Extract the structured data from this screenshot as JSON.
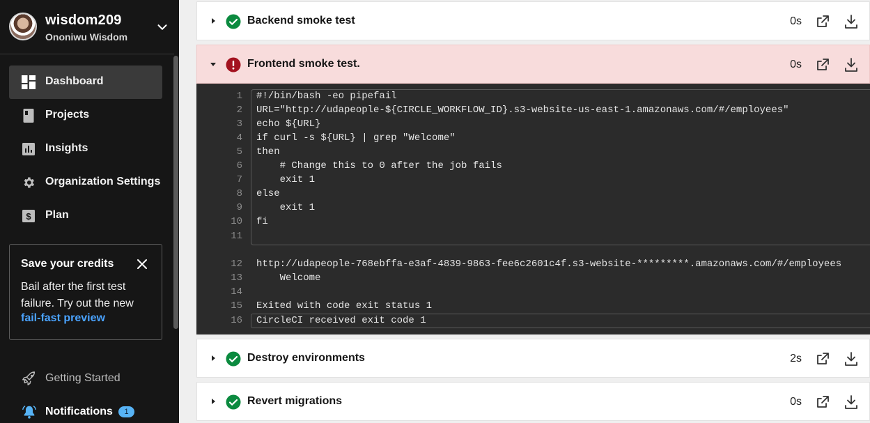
{
  "user": {
    "username": "wisdom209",
    "full_name": "Ononiwu Wisdom"
  },
  "nav": [
    {
      "label": "Dashboard",
      "icon": "dashboard-icon",
      "active": true
    },
    {
      "label": "Projects",
      "icon": "projects-icon",
      "active": false
    },
    {
      "label": "Insights",
      "icon": "insights-icon",
      "active": false
    },
    {
      "label": "Organization Settings",
      "icon": "gear-icon",
      "active": false
    },
    {
      "label": "Plan",
      "icon": "dollar-icon",
      "active": false
    }
  ],
  "credits": {
    "title": "Save your credits",
    "body": "Bail after the first test failure. Try out the new",
    "link": "fail-fast preview"
  },
  "footer": {
    "getting_started": "Getting Started",
    "notifications": "Notifications",
    "notification_count": "1"
  },
  "steps": {
    "backend": {
      "name": "Backend smoke test",
      "duration": "0s",
      "status": "success"
    },
    "frontend": {
      "name": "Frontend smoke test.",
      "duration": "0s",
      "status": "failed"
    },
    "destroy": {
      "name": "Destroy environments",
      "duration": "2s",
      "status": "success"
    },
    "revert": {
      "name": "Revert migrations",
      "duration": "0s",
      "status": "success"
    }
  },
  "console_lines": [
    {
      "n": "1",
      "t": "#!/bin/bash -eo pipefail"
    },
    {
      "n": "2",
      "t": "URL=\"http://udapeople-${CIRCLE_WORKFLOW_ID}.s3-website-us-east-1.amazonaws.com/#/employees\""
    },
    {
      "n": "3",
      "t": "echo ${URL}"
    },
    {
      "n": "4",
      "t": "if curl -s ${URL} | grep \"Welcome\""
    },
    {
      "n": "5",
      "t": "then"
    },
    {
      "n": "6",
      "t": "    # Change this to 0 after the job fails"
    },
    {
      "n": "7",
      "t": "    exit 1"
    },
    {
      "n": "8",
      "t": "else"
    },
    {
      "n": "9",
      "t": "    exit 1"
    },
    {
      "n": "10",
      "t": "fi"
    },
    {
      "n": "11",
      "t": ""
    },
    {
      "n": "12",
      "t": "http://udapeople-768ebffa-e3af-4839-9863-fee6c2601c4f.s3-website-*********.amazonaws.com/#/employees"
    },
    {
      "n": "13",
      "t": "    Welcome"
    },
    {
      "n": "14",
      "t": ""
    },
    {
      "n": "15",
      "t": "Exited with code exit status 1"
    },
    {
      "n": "16",
      "t": "CircleCI received exit code 1"
    }
  ],
  "colors": {
    "success": "#0b8a3f",
    "error": "#a3121f",
    "link": "#4aa3ff",
    "sidebar": "#161616"
  }
}
